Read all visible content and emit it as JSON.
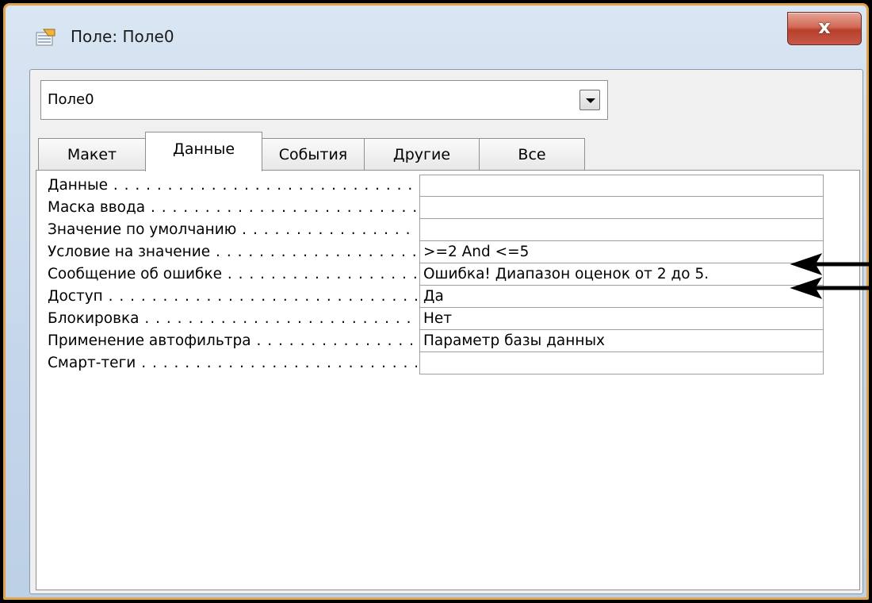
{
  "window": {
    "title": "Поле: Поле0",
    "close_label": "x"
  },
  "object_select": {
    "value": "Поле0"
  },
  "tabs": [
    {
      "label": "Макет"
    },
    {
      "label": "Данные"
    },
    {
      "label": "События"
    },
    {
      "label": "Другие"
    },
    {
      "label": "Все"
    }
  ],
  "active_tab": "Данные",
  "properties": [
    {
      "label": "Данные",
      "value": ""
    },
    {
      "label": "Маска ввода",
      "value": ""
    },
    {
      "label": "Значение по умолчанию",
      "value": ""
    },
    {
      "label": "Условие на значение",
      "value": ">=2 And <=5"
    },
    {
      "label": "Сообщение об ошибке",
      "value": "Ошибка! Диапазон оценок от 2 до 5."
    },
    {
      "label": "Доступ",
      "value": "Да"
    },
    {
      "label": "Блокировка",
      "value": "Нет"
    },
    {
      "label": "Применение автофильтра",
      "value": "Параметр базы данных"
    },
    {
      "label": "Смарт-теги",
      "value": ""
    }
  ],
  "colors": {
    "window_border": "#e3a34b",
    "close_button": "#c9584a",
    "background": "#000000"
  },
  "icons": {
    "title": "property-sheet-icon",
    "combo": "chevron-down-icon",
    "close": "close-icon"
  }
}
